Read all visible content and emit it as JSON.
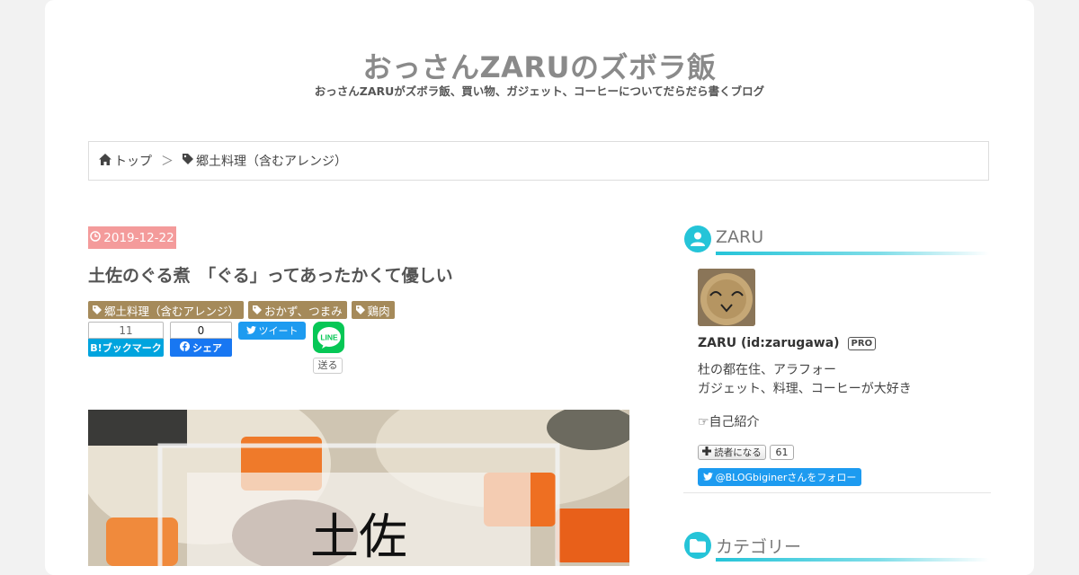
{
  "blog": {
    "title": "おっさんZARUのズボラ飯",
    "description": "おっさんZARUがズボラ飯、買い物、ガジェット、コーヒーについてだらだら書くブログ"
  },
  "breadcrumb": {
    "home": "トップ",
    "separator": "＞",
    "category": "郷土料理（含むアレンジ）"
  },
  "entry": {
    "date": "2019-12-22",
    "title": "土佐のぐる煮　「ぐる」ってあったかくて優しい",
    "tags": [
      "郷土料理（含むアレンジ）",
      "おかず、つまみ",
      "鶏肉"
    ],
    "share": {
      "hatena_count": "11",
      "hatena_label": "B!ブックマーク",
      "facebook_count": "0",
      "facebook_label": "シェア",
      "twitter_label": "ツイート",
      "line_label": "送る",
      "line_icon_text": "LINE"
    },
    "eyecatch_text": "土佐"
  },
  "sidebar": {
    "profile": {
      "heading": "ZARU",
      "name": "ZARU (id:zarugawa)",
      "badge": "PRO",
      "description_line1": "杜の都在住、アラフォー",
      "description_line2": "ガジェット、料理、コーヒーが大好き",
      "link": "☞自己紹介",
      "reader_button": "読者になる",
      "reader_count": "61",
      "follow_button": "@BLOGbiginerさんをフォロー"
    },
    "category_heading": "カテゴリー"
  },
  "colors": {
    "accent": "#25c4d8",
    "date_badge": "#f49b9b",
    "tag": "#a58a5a",
    "hatena": "#00a4de",
    "facebook": "#1877f2",
    "twitter": "#1d9bf0",
    "line": "#06c755"
  }
}
